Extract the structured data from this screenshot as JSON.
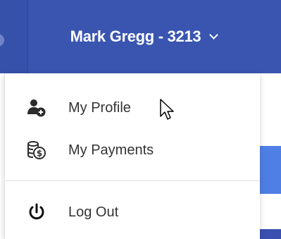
{
  "header": {
    "account_label": "Mark Gregg - 3213",
    "chevron_icon": "chevron-down-icon"
  },
  "menu": {
    "items": [
      {
        "label": "My Profile",
        "icon": "user-add-icon"
      },
      {
        "label": "My Payments",
        "icon": "coins-dollar-icon"
      },
      {
        "label": "Log Out",
        "icon": "power-icon"
      }
    ]
  },
  "colors": {
    "navbar": "#3955b0",
    "accent_band": "#4f7fe4",
    "text": "#333333"
  }
}
